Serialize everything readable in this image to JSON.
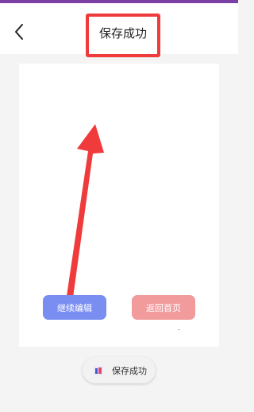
{
  "header": {
    "title": "保存成功"
  },
  "actions": {
    "continue_edit_label": "继续编辑",
    "back_home_label": "返回首页"
  },
  "toast": {
    "message": "保存成功"
  },
  "colors": {
    "status_bar": "#7b3fa6",
    "highlight": "#ef3b3b",
    "continue_edit": "#7a8ef2",
    "back_home": "#f19b9d",
    "arrow": "#ef3b3b"
  },
  "icons": {
    "back": "chevron-left-icon",
    "app": "app-icon"
  }
}
